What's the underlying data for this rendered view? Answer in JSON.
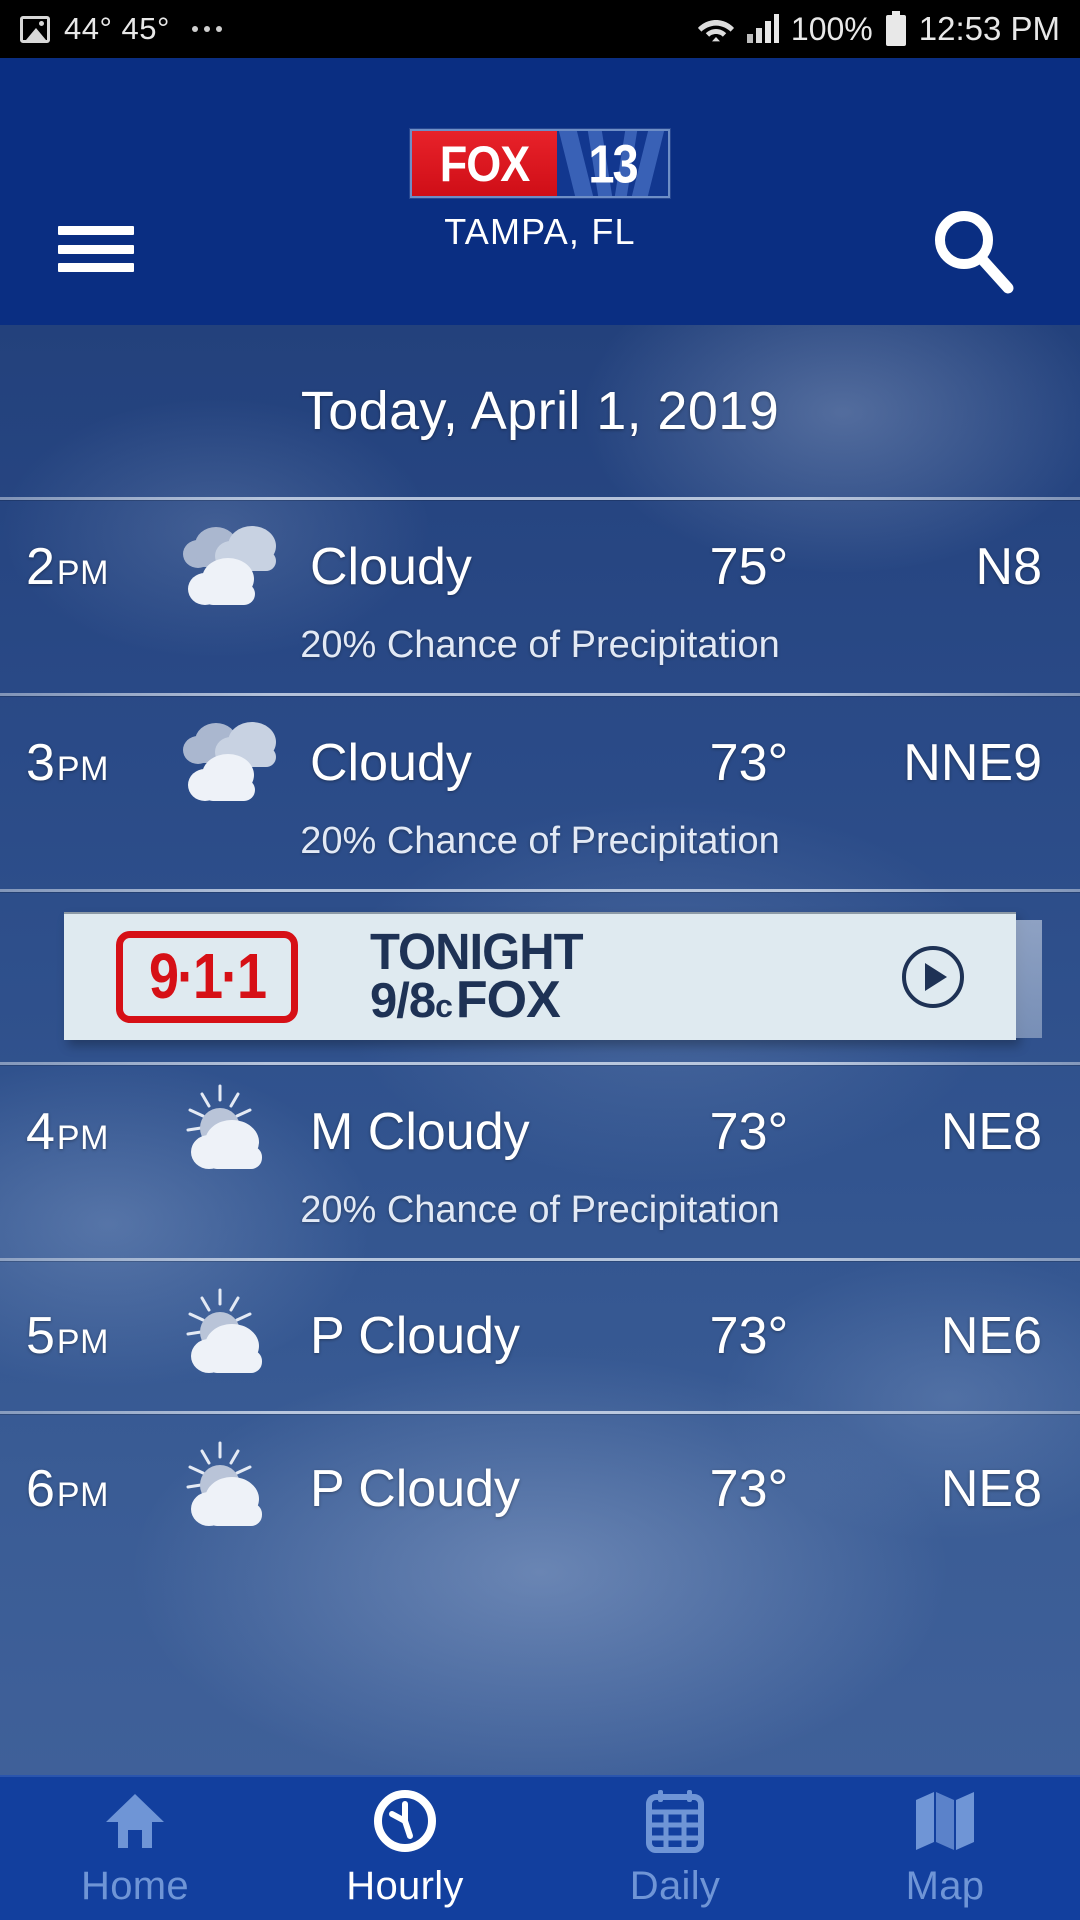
{
  "status_bar": {
    "image_icon": "image-icon",
    "temps": "44°  45°",
    "overflow": "more-dots-icon",
    "wifi_icon": "wifi-icon",
    "signal_icon": "cellular-signal-icon",
    "battery_percent": "100%",
    "battery_icon": "battery-full-icon",
    "time": "12:53 PM"
  },
  "header": {
    "menu_icon": "hamburger-menu-icon",
    "logo_fox": "FOX",
    "logo_channel": "13",
    "city": "TAMPA, FL",
    "search_icon": "search-icon",
    "background_color": "#0a2e82"
  },
  "main": {
    "date_title": "Today, April 1, 2019",
    "precip_suffix": "Chance of Precipitation",
    "rows": [
      {
        "time": "2",
        "meridiem": "PM",
        "icon": "cloudy-icon",
        "condition": "Cloudy",
        "temp": "75°",
        "wind": "N8",
        "precip": "20% Chance of Precipitation"
      },
      {
        "time": "3",
        "meridiem": "PM",
        "icon": "cloudy-icon",
        "condition": "Cloudy",
        "temp": "73°",
        "wind": "NNE9",
        "precip": "20% Chance of Precipitation"
      },
      {
        "time": "4",
        "meridiem": "PM",
        "icon": "partly-cloudy-icon",
        "condition": "M Cloudy",
        "temp": "73°",
        "wind": "NE8",
        "precip": "20% Chance of Precipitation"
      },
      {
        "time": "5",
        "meridiem": "PM",
        "icon": "partly-cloudy-icon",
        "condition": "P Cloudy",
        "temp": "73°",
        "wind": "NE6",
        "precip": ""
      },
      {
        "time": "6",
        "meridiem": "PM",
        "icon": "partly-cloudy-icon",
        "condition": "P Cloudy",
        "temp": "73°",
        "wind": "NE8",
        "precip": ""
      }
    ]
  },
  "ad": {
    "logo_text": "9·1·1",
    "line1": "TONIGHT",
    "line2_time": "9/8",
    "line2_c": "c",
    "line2_network": "FOX",
    "play_icon": "play-button-icon",
    "background_color": "#dfeaf0",
    "accent_color": "#d61016",
    "text_color": "#1e3255"
  },
  "bottom_nav": {
    "active": "Hourly",
    "items": [
      {
        "label": "Home",
        "icon": "home-icon"
      },
      {
        "label": "Hourly",
        "icon": "clock-icon"
      },
      {
        "label": "Daily",
        "icon": "calendar-icon"
      },
      {
        "label": "Map",
        "icon": "map-icon"
      }
    ],
    "background_color": "#123f9e",
    "inactive_color": "#6f95d6",
    "active_color": "#ffffff"
  }
}
